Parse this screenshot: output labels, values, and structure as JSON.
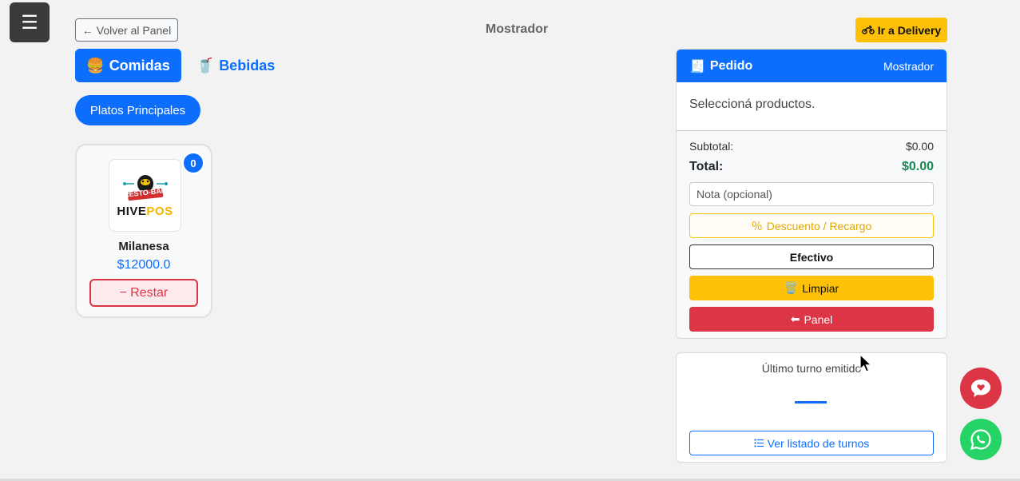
{
  "header": {
    "menu_icon": "☰",
    "back_icon": "←",
    "back_label": "Volver al Panel",
    "title": "Mostrador",
    "delivery_icon": "motorcycle-icon",
    "delivery_label": "Ir a Delivery"
  },
  "tabs": [
    {
      "icon": "🍔",
      "label": "Comidas",
      "active": true
    },
    {
      "icon": "🥤",
      "label": "Bebidas",
      "active": false
    }
  ],
  "categories": [
    {
      "label": "Platos Principales",
      "active": true
    }
  ],
  "products": [
    {
      "name": "Milanesa",
      "price": "$12000.0",
      "quantity": "0",
      "logo_top": "RESTO-BAR",
      "logo_bottom_a": "HIVE",
      "logo_bottom_b": "POS",
      "remove_icon": "−",
      "remove_label": "Restar"
    }
  ],
  "order": {
    "icon": "🧾",
    "title": "Pedido",
    "mode": "Mostrador",
    "empty_message": "Seleccioná productos.",
    "subtotal_label": "Subtotal:",
    "subtotal_value": "$0.00",
    "total_label": "Total:",
    "total_value": "$0.00",
    "note_placeholder": "Nota (opcional)",
    "discount_icon": "％",
    "discount_label": "Descuento / Recargo",
    "payment_label": "Efectivo",
    "clear_icon": "🗑️",
    "clear_label": "Limpiar",
    "panel_icon": "⬅",
    "panel_label": "Panel"
  },
  "turn": {
    "title": "Último turno emitido",
    "list_icon": "list-icon",
    "list_label": "Ver listado de turnos"
  },
  "colors": {
    "primary": "#0d6efd",
    "warning": "#ffc107",
    "danger": "#dc3545",
    "success": "#198754",
    "whatsapp": "#25d366"
  }
}
